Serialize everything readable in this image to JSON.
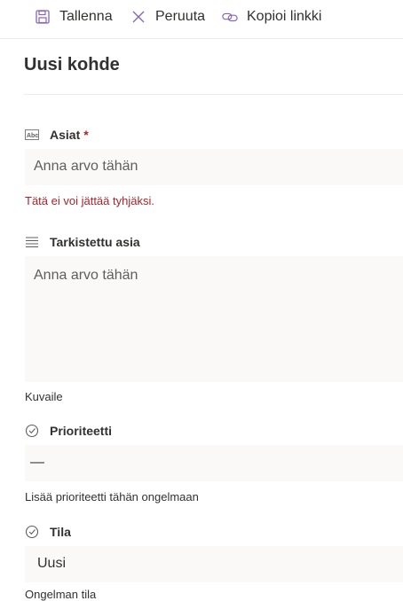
{
  "toolbar": {
    "save_label": "Tallenna",
    "cancel_label": "Peruuta",
    "copy_link_label": "Kopioi linkki"
  },
  "form": {
    "title": "Uusi kohde",
    "fields": {
      "asiat": {
        "label": "Asiat",
        "required_marker": "*",
        "placeholder": "Anna arvo tähän",
        "error": "Tätä ei voi jättää tyhjäksi.",
        "icon": "text-abc-icon"
      },
      "tarkistettu_asia": {
        "label": "Tarkistettu asia",
        "placeholder": "Anna arvo tähän",
        "description": "Kuvaile",
        "icon": "multiline-text-icon"
      },
      "prioriteetti": {
        "label": "Prioriteetti",
        "value": "—",
        "description": "Lisää prioriteetti tähän ongelmaan",
        "icon": "choice-check-icon"
      },
      "tila": {
        "label": "Tila",
        "value": "Uusi",
        "description": "Ongelman tila",
        "icon": "choice-check-icon"
      }
    }
  },
  "colors": {
    "accent": "#8764b8",
    "error": "#a4262c",
    "field_bg": "#faf9f8",
    "text": "#323130",
    "placeholder": "#605e5c"
  }
}
